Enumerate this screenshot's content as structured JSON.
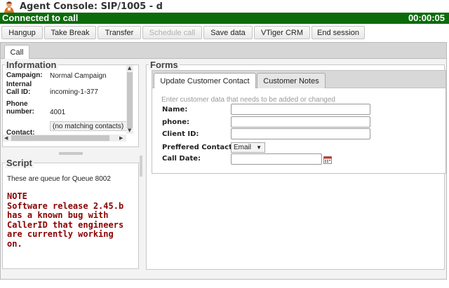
{
  "window": {
    "title": "Agent Console: SIP/1005 - d",
    "status_text": "Connected to call",
    "timer": "00:00:05"
  },
  "toolbar": {
    "buttons": [
      {
        "label": "Hangup",
        "enabled": true
      },
      {
        "label": "Take Break",
        "enabled": true
      },
      {
        "label": "Transfer",
        "enabled": true
      },
      {
        "label": "Schedule call",
        "enabled": false
      },
      {
        "label": "Save data",
        "enabled": true
      },
      {
        "label": "VTiger CRM",
        "enabled": true
      },
      {
        "label": "End session",
        "enabled": true
      }
    ]
  },
  "main_tabs": [
    {
      "label": "Call",
      "active": true
    }
  ],
  "information": {
    "title": "Information",
    "fields": [
      {
        "label": "Campaign:",
        "value": "Normal Campaign"
      },
      {
        "label": "Internal Call ID:",
        "value": "incoming-1-377"
      },
      {
        "label": "Phone number:",
        "value": "4001"
      },
      {
        "label": "Contact:",
        "value": "(no matching contacts)"
      }
    ]
  },
  "script": {
    "title": "Script",
    "text": "These are queue for Queue 8002",
    "note": "NOTE\nSoftware release 2.45.b has a known bug with CallerID that engineers are currently working on."
  },
  "forms": {
    "title": "Forms",
    "tabs": [
      {
        "label": "Update Customer Contact",
        "active": true
      },
      {
        "label": "Customer Notes",
        "active": false
      }
    ],
    "hint": "Enter customer data that needs to be added or changed",
    "fields": [
      {
        "label": "Name:",
        "value": ""
      },
      {
        "label": "phone:",
        "value": ""
      },
      {
        "label": "Client ID:",
        "value": ""
      },
      {
        "label": "Preffered Contact:",
        "value": "Email"
      },
      {
        "label": "Call Date:",
        "value": ""
      }
    ]
  },
  "colors": {
    "status_bar": "#0b6b0b",
    "note_text": "#8b0000"
  }
}
